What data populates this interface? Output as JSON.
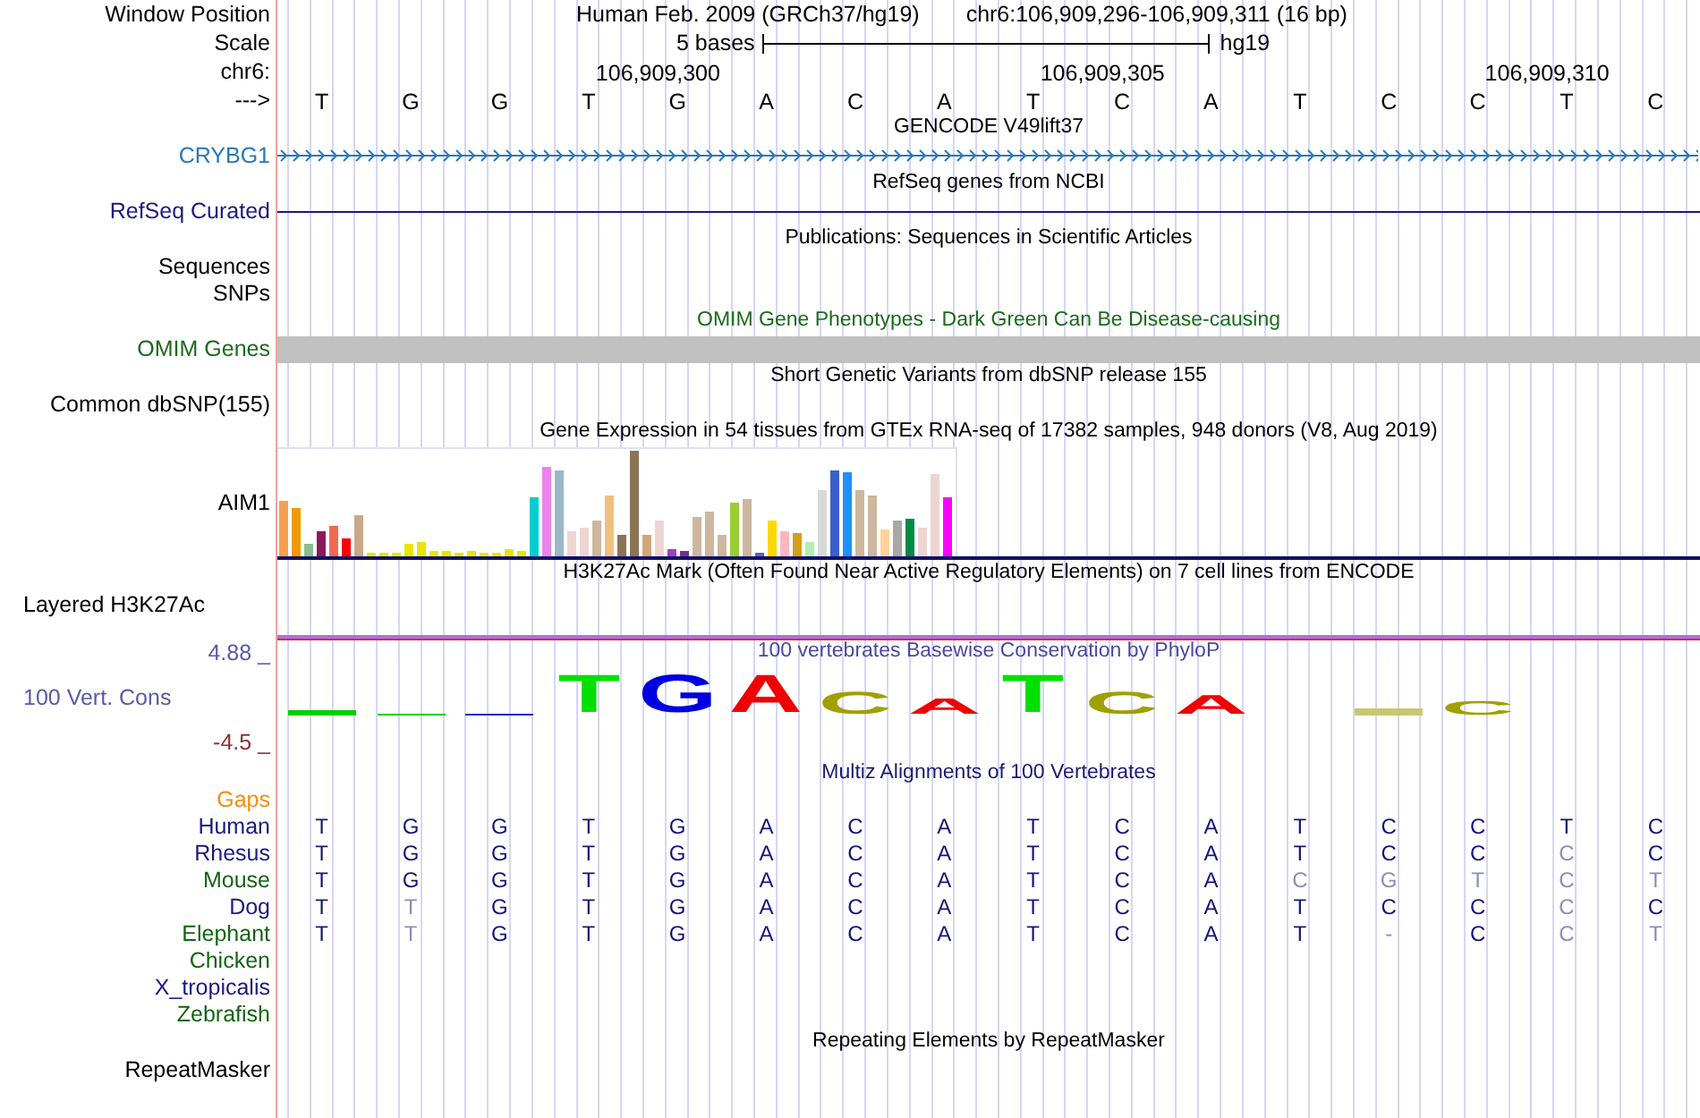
{
  "header": {
    "labels": [
      "Window Position",
      "Scale",
      "chr6:",
      "--->"
    ],
    "assembly": "Human Feb. 2009 (GRCh37/hg19)",
    "position": "chr6:106,909,296-106,909,311 (16 bp)",
    "scale_text": "5 bases",
    "scale_db": "hg19",
    "ruler_ticks": [
      "106,909,300",
      "106,909,305",
      "106,909,310"
    ],
    "bases": [
      "T",
      "G",
      "G",
      "T",
      "G",
      "A",
      "C",
      "A",
      "T",
      "C",
      "A",
      "T",
      "C",
      "C",
      "T",
      "C"
    ]
  },
  "tracks": [
    {
      "kind": "gene",
      "title": {
        "text": "GENCODE V49lift37",
        "color": "#000000"
      },
      "labels": [
        "CRYBG1"
      ],
      "color": "#2878b8"
    },
    {
      "kind": "line",
      "title": {
        "text": "RefSeq genes from NCBI",
        "color": "#000000"
      },
      "labels": [
        "RefSeq Curated"
      ],
      "color": "#1a1a80"
    },
    {
      "kind": "empty",
      "title": {
        "text": "Publications: Sequences in Scientific Articles",
        "color": "#000000"
      },
      "labels": [
        "Sequences",
        "SNPs"
      ],
      "color": "#000000"
    },
    {
      "kind": "bar",
      "title": {
        "text": "OMIM Gene Phenotypes - Dark Green Can Be Disease-causing",
        "color": "#1b6b1b"
      },
      "labels": [
        "OMIM Genes"
      ],
      "color": "#1b6b1b"
    },
    {
      "kind": "empty",
      "title": {
        "text": "Short Genetic Variants from dbSNP release 155",
        "color": "#000000"
      },
      "labels": [
        "Common dbSNP(155)"
      ],
      "color": "#000000"
    },
    {
      "kind": "expression",
      "title": {
        "text": "Gene Expression in 54 tissues from GTEx RNA-seq of 17382 samples, 948 donors (V8, Aug 2019)",
        "color": "#000000"
      },
      "labels": [
        "AIM1"
      ],
      "color": "#000000"
    },
    {
      "kind": "layered",
      "title": {
        "text": "H3K27Ac Mark (Often Found Near Active Regulatory Elements) on 7 cell lines from ENCODE",
        "color": "#000000"
      },
      "labels": [
        "Layered H3K27Ac"
      ],
      "color": "#000000"
    },
    {
      "kind": "conservation",
      "title": {
        "text": "100 vertebrates Basewise Conservation by PhyloP",
        "color": "#4a4aa0"
      },
      "labels": [
        "100 Vert. Cons"
      ],
      "color": "#5a5aa8",
      "max": {
        "text": "4.88 _",
        "color": "#5a5aa8"
      },
      "min": {
        "text": "-4.5 _",
        "color": "#8b3030"
      },
      "logo": [
        {
          "kind": "mark",
          "color": "#00d000"
        },
        {
          "kind": "mark",
          "color": "#00d000"
        },
        {
          "kind": "mark",
          "color": "#2020c0"
        },
        {
          "kind": "letter",
          "base": "T",
          "color": "#00e000"
        },
        {
          "kind": "letter",
          "base": "G",
          "color": "#0000e0"
        },
        {
          "kind": "letter",
          "base": "A",
          "color": "#f00000"
        },
        {
          "kind": "letter",
          "base": "C",
          "color": "#a0a000"
        },
        {
          "kind": "letter",
          "base": "A",
          "color": "#f00000"
        },
        {
          "kind": "letter",
          "base": "T",
          "color": "#00e000"
        },
        {
          "kind": "letter",
          "base": "C",
          "color": "#a0a000"
        },
        {
          "kind": "letter",
          "base": "A",
          "color": "#f00000"
        },
        {
          "kind": "gap"
        },
        {
          "kind": "mark",
          "color": "#c8c870"
        },
        {
          "kind": "letter",
          "base": "C",
          "color": "#a0a000"
        },
        {
          "kind": "gap"
        },
        {
          "kind": "gap"
        }
      ]
    },
    {
      "kind": "multiz",
      "title": {
        "text": "Multiz Alignments of 100 Vertebrates",
        "color": "#1a1a70"
      },
      "labels": [
        "Gaps"
      ],
      "color": "#f0900f",
      "species": [
        {
          "name": "Human",
          "color": "#1a1a80",
          "bases": [
            {
              "base": "T",
              "faded": false
            },
            {
              "base": "G",
              "faded": false
            },
            {
              "base": "G",
              "faded": false
            },
            {
              "base": "T",
              "faded": false
            },
            {
              "base": "G",
              "faded": false
            },
            {
              "base": "A",
              "faded": false
            },
            {
              "base": "C",
              "faded": false
            },
            {
              "base": "A",
              "faded": false
            },
            {
              "base": "T",
              "faded": false
            },
            {
              "base": "C",
              "faded": false
            },
            {
              "base": "A",
              "faded": false
            },
            {
              "base": "T",
              "faded": false
            },
            {
              "base": "C",
              "faded": false
            },
            {
              "base": "C",
              "faded": false
            },
            {
              "base": "T",
              "faded": false
            },
            {
              "base": "C",
              "faded": false
            }
          ]
        },
        {
          "name": "Rhesus",
          "color": "#1a1a80",
          "bases": [
            {
              "base": "T",
              "faded": false
            },
            {
              "base": "G",
              "faded": false
            },
            {
              "base": "G",
              "faded": false
            },
            {
              "base": "T",
              "faded": false
            },
            {
              "base": "G",
              "faded": false
            },
            {
              "base": "A",
              "faded": false
            },
            {
              "base": "C",
              "faded": false
            },
            {
              "base": "A",
              "faded": false
            },
            {
              "base": "T",
              "faded": false
            },
            {
              "base": "C",
              "faded": false
            },
            {
              "base": "A",
              "faded": false
            },
            {
              "base": "T",
              "faded": false
            },
            {
              "base": "C",
              "faded": false
            },
            {
              "base": "C",
              "faded": false
            },
            {
              "base": "C",
              "faded": true
            },
            {
              "base": "C",
              "faded": false
            }
          ]
        },
        {
          "name": "Mouse",
          "color": "#146414",
          "bases": [
            {
              "base": "T",
              "faded": false
            },
            {
              "base": "G",
              "faded": false
            },
            {
              "base": "G",
              "faded": false
            },
            {
              "base": "T",
              "faded": false
            },
            {
              "base": "G",
              "faded": false
            },
            {
              "base": "A",
              "faded": false
            },
            {
              "base": "C",
              "faded": false
            },
            {
              "base": "A",
              "faded": false
            },
            {
              "base": "T",
              "faded": false
            },
            {
              "base": "C",
              "faded": false
            },
            {
              "base": "A",
              "faded": false
            },
            {
              "base": "C",
              "faded": true
            },
            {
              "base": "G",
              "faded": true
            },
            {
              "base": "T",
              "faded": true
            },
            {
              "base": "C",
              "faded": true
            },
            {
              "base": "T",
              "faded": true
            }
          ]
        },
        {
          "name": "Dog",
          "color": "#1a1a80",
          "bases": [
            {
              "base": "T",
              "faded": false
            },
            {
              "base": "T",
              "faded": true
            },
            {
              "base": "G",
              "faded": false
            },
            {
              "base": "T",
              "faded": false
            },
            {
              "base": "G",
              "faded": false
            },
            {
              "base": "A",
              "faded": false
            },
            {
              "base": "C",
              "faded": false
            },
            {
              "base": "A",
              "faded": false
            },
            {
              "base": "T",
              "faded": false
            },
            {
              "base": "C",
              "faded": false
            },
            {
              "base": "A",
              "faded": false
            },
            {
              "base": "T",
              "faded": false
            },
            {
              "base": "C",
              "faded": false
            },
            {
              "base": "C",
              "faded": false
            },
            {
              "base": "C",
              "faded": true
            },
            {
              "base": "C",
              "faded": false
            }
          ]
        },
        {
          "name": "Elephant",
          "color": "#146414",
          "bases": [
            {
              "base": "T",
              "faded": false
            },
            {
              "base": "T",
              "faded": true
            },
            {
              "base": "G",
              "faded": false
            },
            {
              "base": "T",
              "faded": false
            },
            {
              "base": "G",
              "faded": false
            },
            {
              "base": "A",
              "faded": false
            },
            {
              "base": "C",
              "faded": false
            },
            {
              "base": "A",
              "faded": false
            },
            {
              "base": "T",
              "faded": false
            },
            {
              "base": "C",
              "faded": false
            },
            {
              "base": "A",
              "faded": false
            },
            {
              "base": "T",
              "faded": false
            },
            {
              "base": "-",
              "faded": true
            },
            {
              "base": "C",
              "faded": false
            },
            {
              "base": "C",
              "faded": true
            },
            {
              "base": "T",
              "faded": true
            }
          ]
        },
        {
          "name": "Chicken",
          "color": "#146414"
        },
        {
          "name": "X_tropicalis",
          "color": "#1a1a80"
        },
        {
          "name": "Zebrafish",
          "color": "#146414"
        }
      ]
    },
    {
      "kind": "empty",
      "title": {
        "text": "Repeating Elements by RepeatMasker",
        "color": "#000000"
      },
      "labels": [
        "RepeatMasker"
      ],
      "color": "#000000"
    }
  ]
}
